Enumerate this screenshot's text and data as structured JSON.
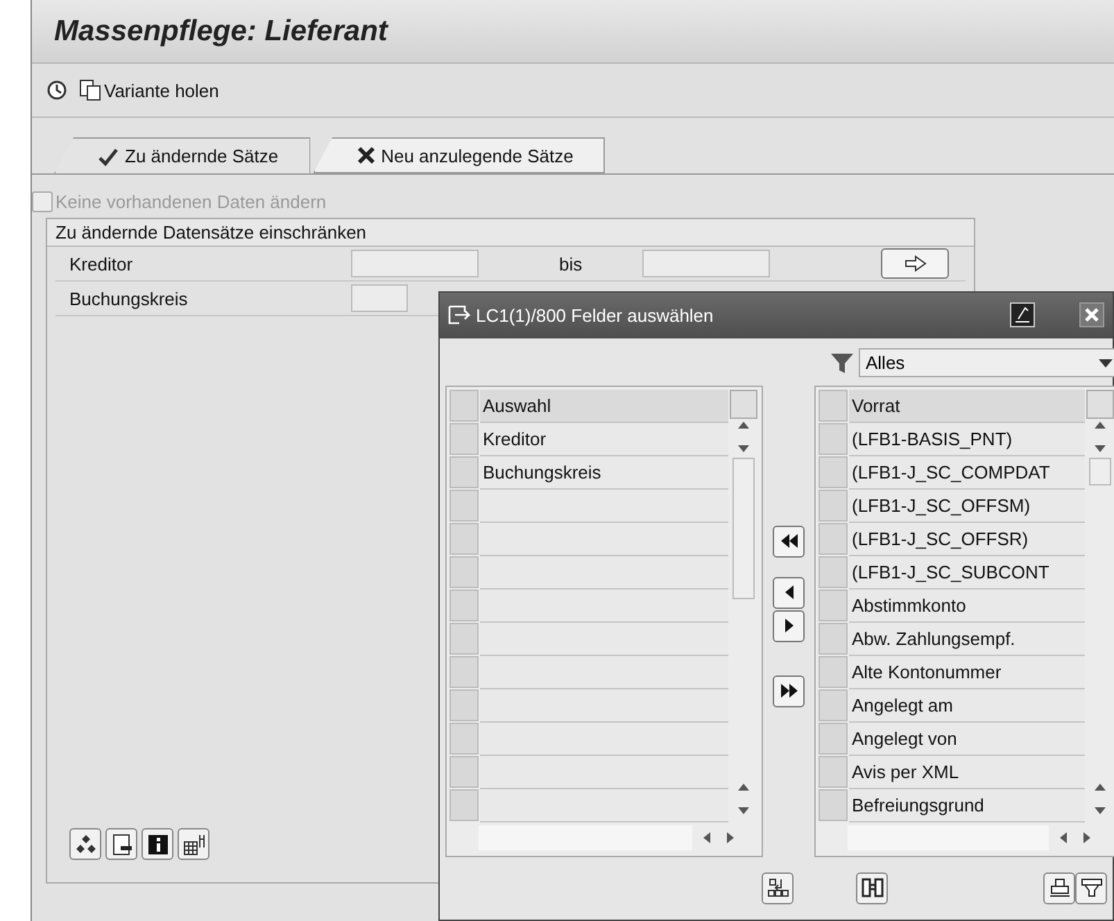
{
  "window": {
    "title": "Massenpflege: Lieferant"
  },
  "toolbar": {
    "buttons": [
      {
        "label": "Variante holen"
      }
    ]
  },
  "tabs": [
    {
      "label": "Zu ändernde Sätze",
      "selected": true
    },
    {
      "label": "Neu anzulegende Sätze",
      "selected": false
    }
  ],
  "checkbox": {
    "label": "Keine vorhandenen Daten ändern",
    "checked": false,
    "disabled": true
  },
  "group": {
    "title": "Zu ändernde Datensätze einschränken",
    "rows": [
      {
        "label": "Kreditor",
        "to_label": "bis"
      },
      {
        "label": "Buchungskreis"
      }
    ]
  },
  "dialog": {
    "title": "LC1(1)/800 Felder auswählen",
    "filter": {
      "value": "Alles"
    },
    "selected_list": {
      "header": "Auswahl",
      "rows": [
        "Kreditor",
        "Buchungskreis"
      ]
    },
    "available_list": {
      "header": "Vorrat",
      "rows": [
        "(LFB1-BASIS_PNT)",
        "(LFB1-J_SC_COMPDAT",
        "(LFB1-J_SC_OFFSM)",
        "(LFB1-J_SC_OFFSR)",
        "(LFB1-J_SC_SUBCONT",
        "Abstimmkonto",
        "Abw. Zahlungsempf.",
        "Alte Kontonummer",
        "Angelegt am",
        "Angelegt von",
        "Avis per XML",
        "Befreiungsgrund"
      ]
    }
  }
}
